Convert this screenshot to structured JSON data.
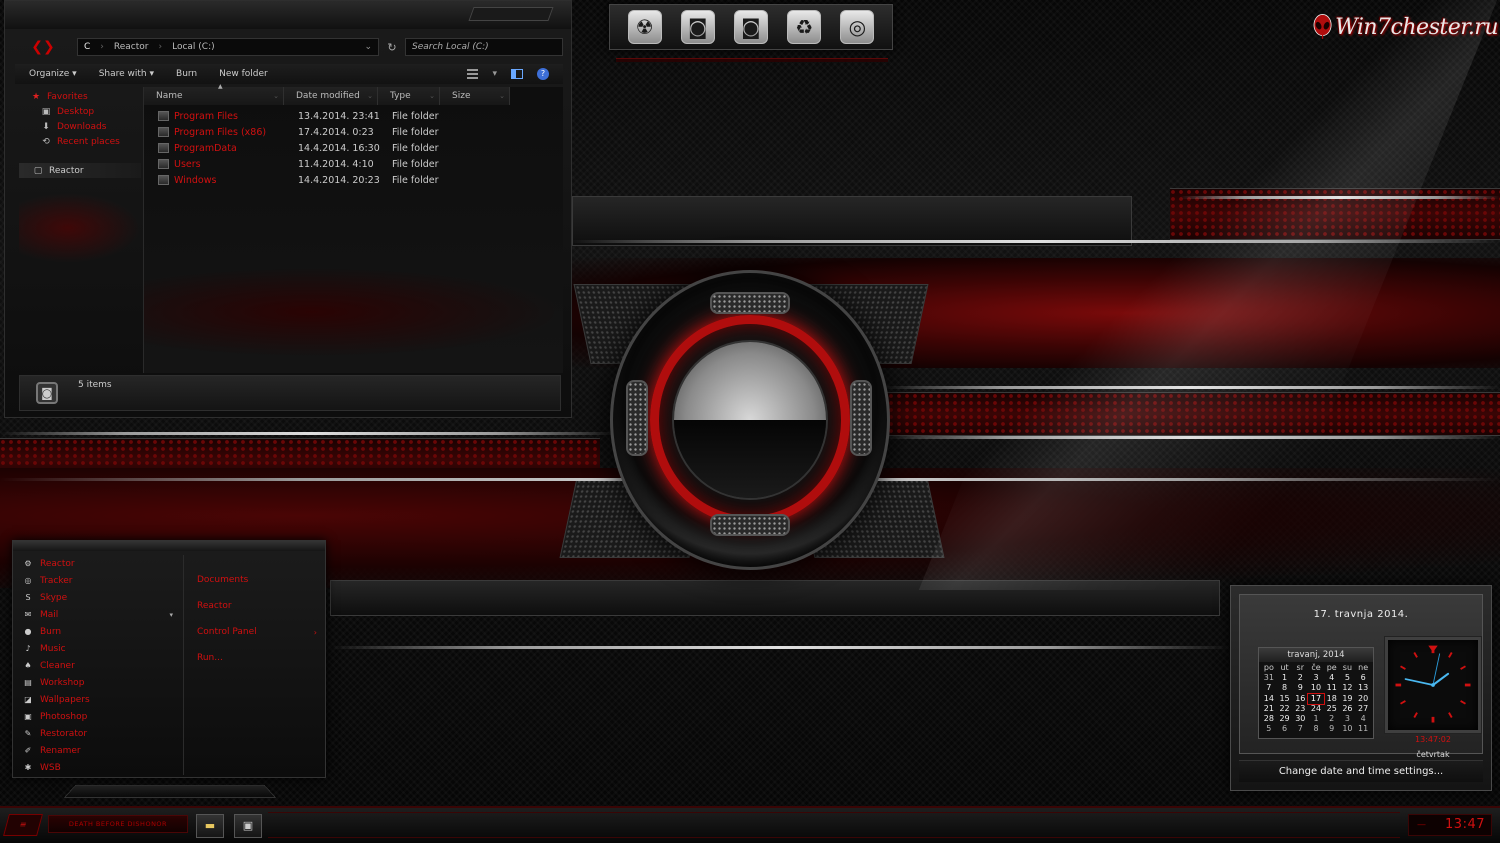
{
  "explorer": {
    "address_drive": "C",
    "address_path": [
      "Reactor",
      "Local (C:)"
    ],
    "search_placeholder": "Search Local (C:)",
    "toolbar": {
      "organize": "Organize ▾",
      "share": "Share with ▾",
      "burn": "Burn",
      "new_folder": "New folder"
    },
    "nav": {
      "favorites": "Favorites",
      "desktop": "Desktop",
      "downloads": "Downloads",
      "recent": "Recent places",
      "reactor": "Reactor"
    },
    "columns": [
      "Name",
      "Date modified",
      "Type",
      "Size"
    ],
    "files": [
      {
        "name": "Program Files",
        "date": "13.4.2014. 23:41",
        "type": "File folder"
      },
      {
        "name": "Program Files (x86)",
        "date": "17.4.2014. 0:23",
        "type": "File folder"
      },
      {
        "name": "ProgramData",
        "date": "14.4.2014. 16:30",
        "type": "File folder"
      },
      {
        "name": "Users",
        "date": "11.4.2014. 4:10",
        "type": "File folder"
      },
      {
        "name": "Windows",
        "date": "14.4.2014. 20:23",
        "type": "File folder"
      }
    ],
    "status": "5 items"
  },
  "dock": {
    "icons": [
      "radiation-icon",
      "drive-icon",
      "drive-alt-icon",
      "recycle-icon",
      "chrome-icon"
    ],
    "glyphs": [
      "☢",
      "◙",
      "◙",
      "♻",
      "◎"
    ]
  },
  "watermark": {
    "text": "Win7chester.ru"
  },
  "startmenu": {
    "programs": [
      {
        "label": "Reactor",
        "icon": "gear-icon",
        "glyph": "⚙"
      },
      {
        "label": "Tracker",
        "icon": "target-icon",
        "glyph": "◎"
      },
      {
        "label": "Skype",
        "icon": "skype-icon",
        "glyph": "S"
      },
      {
        "label": "Mail",
        "icon": "mail-icon",
        "glyph": "✉",
        "has_arrow": true
      },
      {
        "label": "Burn",
        "icon": "disc-icon",
        "glyph": "●"
      },
      {
        "label": "Music",
        "icon": "music-icon",
        "glyph": "♪"
      },
      {
        "label": "Cleaner",
        "icon": "broom-icon",
        "glyph": "♠"
      },
      {
        "label": "Workshop",
        "icon": "folder-icon",
        "glyph": "▤"
      },
      {
        "label": "Wallpapers",
        "icon": "image-icon",
        "glyph": "◪"
      },
      {
        "label": "Photoshop",
        "icon": "photoshop-icon",
        "glyph": "▣"
      },
      {
        "label": "Restorator",
        "icon": "wrench-icon",
        "glyph": "✎"
      },
      {
        "label": "Renamer",
        "icon": "pen-icon",
        "glyph": "✐"
      },
      {
        "label": "WSB",
        "icon": "users-icon",
        "glyph": "✱"
      }
    ],
    "links": [
      {
        "label": "Documents"
      },
      {
        "label": "Reactor"
      },
      {
        "label": "Control Panel",
        "has_arrow": true
      },
      {
        "label": "Run..."
      }
    ]
  },
  "gadget": {
    "date": "17. travnja 2014.",
    "month_label": "travanj, 2014",
    "weekdays": [
      "po",
      "ut",
      "sr",
      "če",
      "pe",
      "su",
      "ne"
    ],
    "days": [
      {
        "d": "31",
        "other": true
      },
      {
        "d": "1"
      },
      {
        "d": "2"
      },
      {
        "d": "3"
      },
      {
        "d": "4"
      },
      {
        "d": "5"
      },
      {
        "d": "6"
      },
      {
        "d": "7"
      },
      {
        "d": "8"
      },
      {
        "d": "9"
      },
      {
        "d": "10"
      },
      {
        "d": "11"
      },
      {
        "d": "12"
      },
      {
        "d": "13"
      },
      {
        "d": "14"
      },
      {
        "d": "15"
      },
      {
        "d": "16"
      },
      {
        "d": "17",
        "today": true
      },
      {
        "d": "18"
      },
      {
        "d": "19"
      },
      {
        "d": "20"
      },
      {
        "d": "21"
      },
      {
        "d": "22"
      },
      {
        "d": "23"
      },
      {
        "d": "24"
      },
      {
        "d": "25"
      },
      {
        "d": "26"
      },
      {
        "d": "27"
      },
      {
        "d": "28"
      },
      {
        "d": "29"
      },
      {
        "d": "30"
      },
      {
        "d": "1",
        "other": true
      },
      {
        "d": "2",
        "other": true
      },
      {
        "d": "3",
        "other": true
      },
      {
        "d": "4",
        "other": true
      },
      {
        "d": "5",
        "other": true
      },
      {
        "d": "6",
        "other": true
      },
      {
        "d": "7",
        "other": true
      },
      {
        "d": "8",
        "other": true
      },
      {
        "d": "9",
        "other": true
      },
      {
        "d": "10",
        "other": true
      },
      {
        "d": "11",
        "other": true
      }
    ],
    "digital_time": "13:47:02",
    "day_name": "četvrtak",
    "hour": 13,
    "minute": 47,
    "second": 2,
    "link": "Change date and time settings..."
  },
  "taskbar": {
    "start_label": "≡",
    "motto": "DEATH BEFORE DISHONOR",
    "apps": [
      {
        "name": "explorer-app",
        "glyph": "▬"
      },
      {
        "name": "media-app",
        "glyph": "▣"
      }
    ],
    "clock": "13:47",
    "accent": "#d01010"
  }
}
